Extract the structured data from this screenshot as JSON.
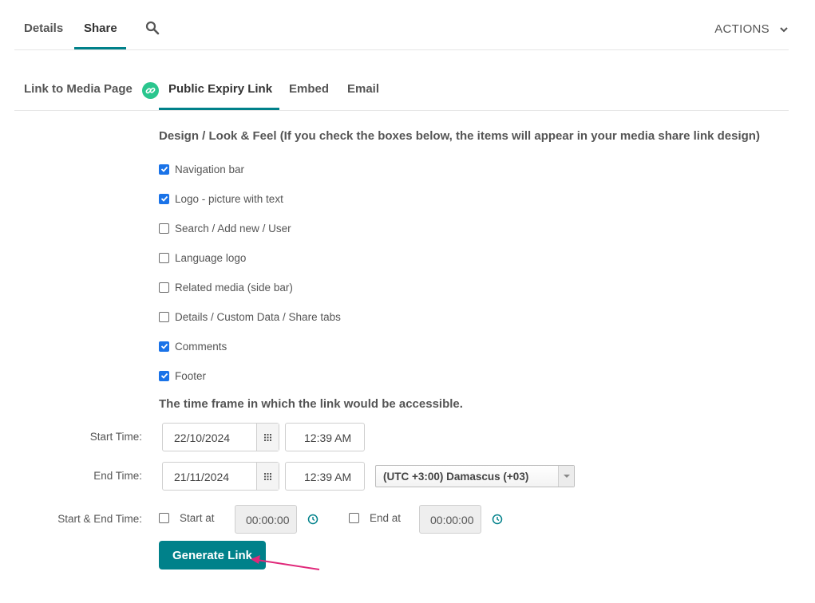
{
  "top_tabs": {
    "details": "Details",
    "share": "Share",
    "actions": "ACTIONS"
  },
  "sub_tabs": {
    "media_page": "Link to Media Page",
    "public_expiry": "Public Expiry Link",
    "embed": "Embed",
    "email": "Email"
  },
  "design": {
    "title": "Design / Look & Feel (If you check the boxes below, the items will appear in your media share link design)",
    "options": [
      {
        "label": "Navigation bar",
        "checked": true
      },
      {
        "label": "Logo - picture with text",
        "checked": true
      },
      {
        "label": "Search / Add new / User",
        "checked": false
      },
      {
        "label": "Language logo",
        "checked": false
      },
      {
        "label": "Related media (side bar)",
        "checked": false
      },
      {
        "label": "Details / Custom Data / Share tabs",
        "checked": false
      },
      {
        "label": "Comments",
        "checked": true
      },
      {
        "label": "Footer",
        "checked": true
      }
    ]
  },
  "timeframe": {
    "title": "The time frame in which the link would be accessible.",
    "start_label": "Start Time:",
    "start_date": "22/10/2024",
    "start_time": "12:39 AM",
    "end_label": "End Time:",
    "end_date": "21/11/2024",
    "end_time": "12:39 AM",
    "timezone": "(UTC +3:00) Damascus (+03)",
    "start_end_label": "Start & End Time:",
    "start_at_label": "Start at",
    "start_at_value": "00:00:00",
    "end_at_label": "End at",
    "end_at_value": "00:00:00"
  },
  "generate_button": "Generate Link",
  "colors": {
    "accent": "#00818a",
    "link_badge": "#2ac68e",
    "checkbox": "#1a73e8",
    "annotation_arrow": "#e0287a"
  },
  "icons": {
    "search": "search-icon",
    "actions_chevron": "chevron-down-icon",
    "link_badge": "link-icon",
    "calendar": "calendar-icon",
    "clock": "clock-icon",
    "dropdown": "caret-down-icon"
  }
}
